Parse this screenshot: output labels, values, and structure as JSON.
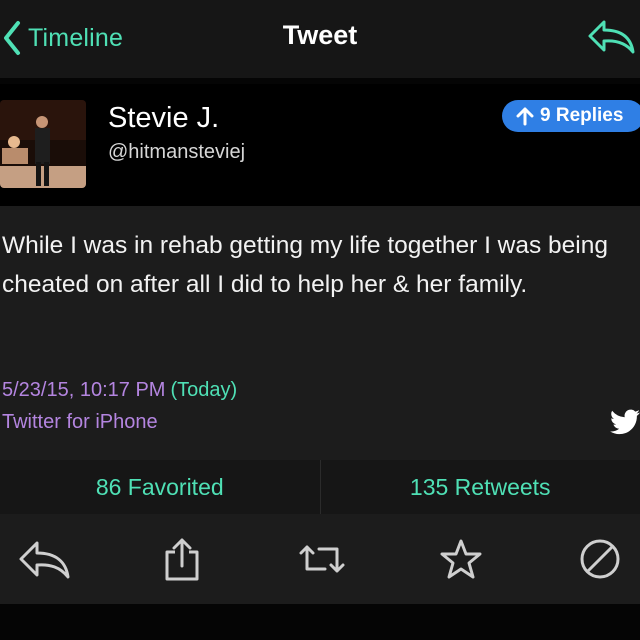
{
  "nav": {
    "back_label": "Timeline",
    "title": "Tweet"
  },
  "author": {
    "display_name": "Stevie J.",
    "username": "@hitmansteviej"
  },
  "replies": {
    "label": "9 Replies"
  },
  "tweet": {
    "text": "While I was in rehab getting my life together I was being cheated on after all I did to help her & her family.",
    "date": "5/23/15, 10:17 PM",
    "relative": "(Today)",
    "source": "Twitter for iPhone"
  },
  "stats": {
    "favorited": "86 Favorited",
    "retweets": "135 Retweets"
  },
  "icons": {
    "back": "chevron-left-icon",
    "nav_reply": "reply-icon",
    "replies": "arrow-up-icon",
    "bird": "twitter-bird-icon",
    "toolbar": [
      "reply-icon",
      "share-icon",
      "retweet-icon",
      "star-icon",
      "block-icon"
    ]
  },
  "colors": {
    "accent": "#4fe0b5",
    "meta": "#b485e0",
    "badge": "#2f7fe5",
    "background": "#1c1c1c"
  }
}
